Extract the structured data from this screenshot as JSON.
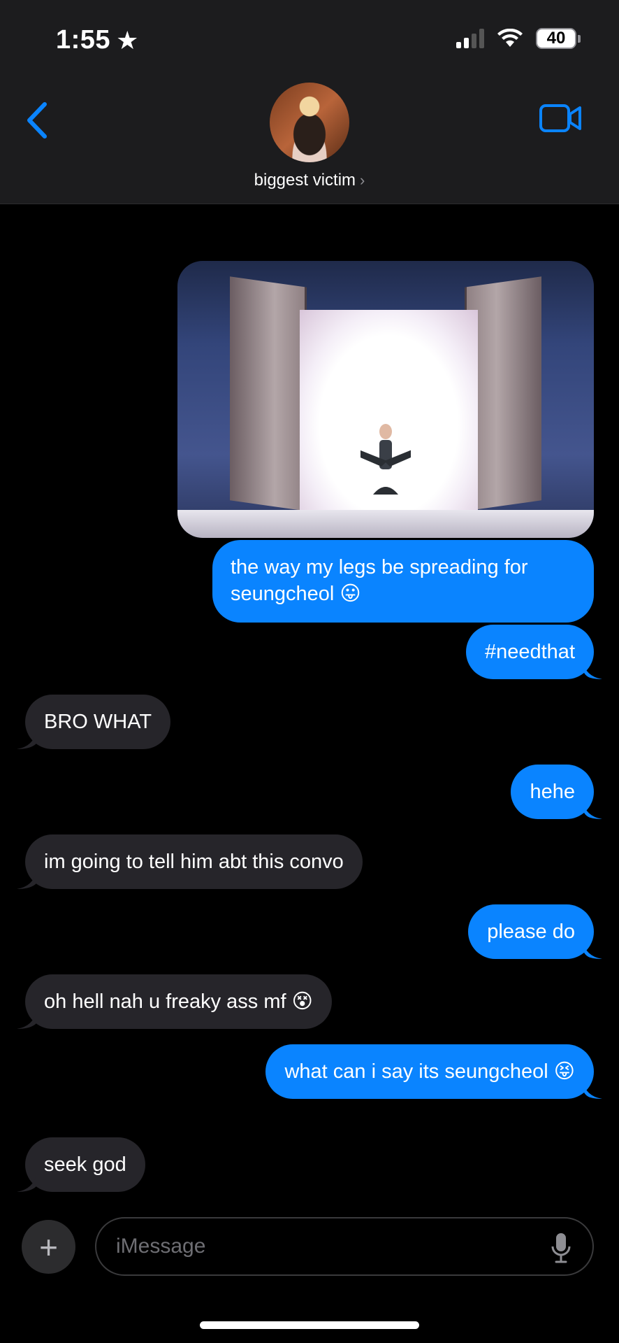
{
  "status_bar": {
    "time": "1:55",
    "battery": "40"
  },
  "header": {
    "contact_name": "biggest victim"
  },
  "messages": [
    {
      "text": "the way my legs be spreading for",
      "text2": "seungcheol 😛"
    },
    {
      "text": "#needthat"
    },
    {
      "text": "BRO WHAT"
    },
    {
      "text": "hehe"
    },
    {
      "text": "im going to tell him abt this convo"
    },
    {
      "text": "please do"
    },
    {
      "text": "oh hell nah u freaky ass mf 😵"
    },
    {
      "text": "what can i say its seungcheol 😝"
    },
    {
      "text": "seek god"
    }
  ],
  "input": {
    "placeholder": "iMessage"
  },
  "colors": {
    "sent_bubble": "#0a84ff",
    "received_bubble": "#26252a",
    "accent": "#0a84ff"
  }
}
